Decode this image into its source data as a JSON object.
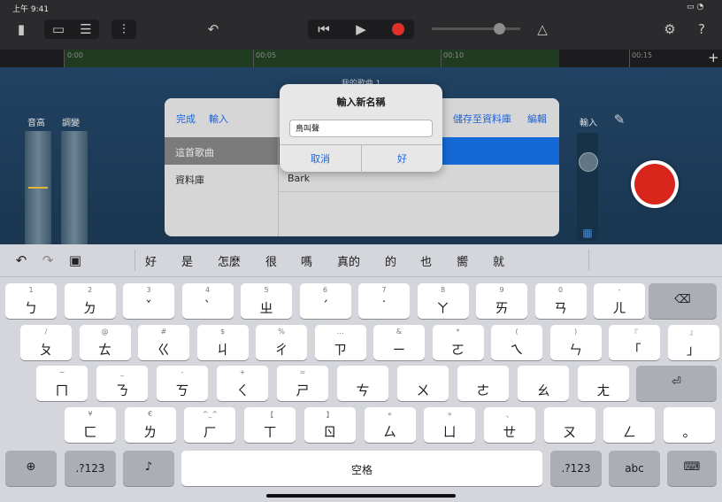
{
  "status": {
    "time": "上午 9:41",
    "battery": "100%"
  },
  "timeline": {
    "ticks": [
      "0:00",
      "00:05",
      "00:10",
      "00:15"
    ]
  },
  "track_title": "我的歌曲 1",
  "controls": {
    "pitch_label": "音高",
    "tune_label": "調變",
    "input_label": "輸入"
  },
  "panel": {
    "done": "完成",
    "input": "輸入",
    "save": "儲存至資料庫",
    "edit": "編輯",
    "sidebar": [
      "這首歌曲",
      "資料庫"
    ],
    "list": [
      "",
      "Bark"
    ]
  },
  "alert": {
    "title": "輸入新名稱",
    "value": "鳥叫聲",
    "cancel": "取消",
    "ok": "好"
  },
  "candidates": [
    "好",
    "是",
    "怎麼",
    "很",
    "嗎",
    "真的",
    "的",
    "也",
    "嚮",
    "就"
  ],
  "keyboard": {
    "row1": [
      [
        "1",
        "ㄅ"
      ],
      [
        "2",
        "ㄉ"
      ],
      [
        "3",
        "ˇ"
      ],
      [
        "4",
        "ˋ"
      ],
      [
        "5",
        "ㄓ"
      ],
      [
        "6",
        "ˊ"
      ],
      [
        "7",
        "˙"
      ],
      [
        "8",
        "ㄚ"
      ],
      [
        "9",
        "ㄞ"
      ],
      [
        "0",
        "ㄢ"
      ],
      [
        "-",
        "ㄦ"
      ]
    ],
    "row2": [
      [
        "/",
        "ㄆ"
      ],
      [
        "@",
        "ㄊ"
      ],
      [
        "#",
        "ㄍ"
      ],
      [
        "$",
        "ㄐ"
      ],
      [
        "%",
        "ㄔ"
      ],
      [
        "…",
        "ㄗ"
      ],
      [
        "&",
        "ㄧ"
      ],
      [
        "*",
        "ㄛ"
      ],
      [
        "(",
        "ㄟ"
      ],
      [
        ")",
        "ㄣ"
      ],
      [
        "『",
        "「"
      ],
      [
        "』",
        "」"
      ]
    ],
    "row3": [
      [
        "~",
        "ㄇ"
      ],
      [
        "_",
        "ㄋ"
      ],
      [
        "-",
        "ㄎ"
      ],
      [
        "+",
        "ㄑ"
      ],
      [
        "=",
        "ㄕ"
      ],
      [
        "",
        "ㄘ"
      ],
      [
        "",
        "ㄨ"
      ],
      [
        "",
        "ㄜ"
      ],
      [
        "",
        "ㄠ"
      ],
      [
        "",
        "ㄤ"
      ]
    ],
    "row4": [
      [
        "¥",
        "ㄈ"
      ],
      [
        "€",
        "ㄌ"
      ],
      [
        "^_^",
        "ㄏ"
      ],
      [
        "【",
        "ㄒ"
      ],
      [
        "】",
        "ㄖ"
      ],
      [
        "«",
        "ㄙ"
      ],
      [
        "»",
        "ㄩ"
      ],
      [
        "、",
        "ㄝ"
      ],
      [
        "",
        "ㄡ"
      ],
      [
        "",
        "ㄥ"
      ],
      [
        "",
        "。"
      ]
    ],
    "space": "空格",
    "numbers": ".?123",
    "abc": "abc"
  }
}
